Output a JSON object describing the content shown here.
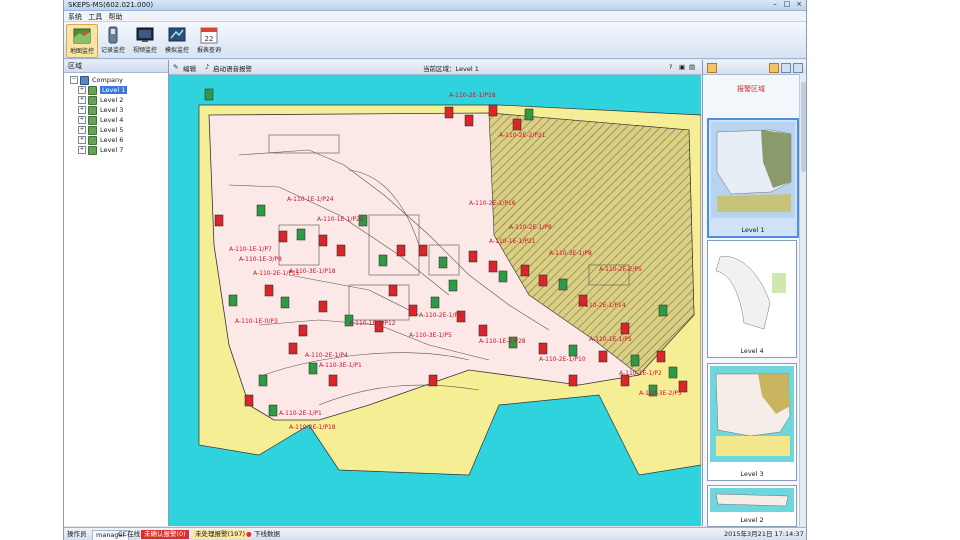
{
  "window": {
    "title": "SKEPS-MS(602.021.000)",
    "minimize": "–",
    "maximize": "□",
    "close": "×"
  },
  "menu": [
    {
      "label": "系统"
    },
    {
      "label": "工具"
    },
    {
      "label": "帮助"
    }
  ],
  "toolbar": [
    {
      "label": "地图监控",
      "icon": "map-icon",
      "active": true
    },
    {
      "label": "记录监控",
      "icon": "record-icon"
    },
    {
      "label": "视频监控",
      "icon": "video-icon"
    },
    {
      "label": "模拟监控",
      "icon": "simulate-icon"
    },
    {
      "label": "报表查询",
      "icon": "calendar-icon",
      "day": "22"
    }
  ],
  "left_panel": {
    "title": "区域",
    "root": "Company",
    "levels": [
      "Level 1",
      "Level 2",
      "Level 3",
      "Level 4",
      "Level 5",
      "Level 6",
      "Level 7"
    ],
    "selected": "Level 1"
  },
  "center_header": {
    "edit_label": "编辑",
    "alarm_label": "启动语音报警",
    "area_label": "当前区域：Level 1"
  },
  "map": {
    "sea_color": "#2fd3dd",
    "land_color": "#fce9e7",
    "beach_color": "#f6ee95",
    "hatch_color": "#c9b560",
    "labels": [
      "A-110-2E-1/P18",
      "A-110-1E-1/P24",
      "A-110-1E-1/P22",
      "A-110-1E-1/P7",
      "A-110-1E-3/P8",
      "A-110-1E-0/P3",
      "A-110-2E-2/P21",
      "A-110-2E-1/P16",
      "A-110-2E-1/P8",
      "A-110-3E-1/P8",
      "A-110-2E-2/P5",
      "A-110-2E-1/P15",
      "A-110-3E-1/P18",
      "A-110-2E-1/P3",
      "A-110-1E-2/P28",
      "A-110-2E-1/P14",
      "A-110-1E-1/P5",
      "A-110-2E-1/P4",
      "A-110-3E-1/P1",
      "A-110-2E-1/P10",
      "A-110-1E-1/P2",
      "A-110-3E-2/P5",
      "A-110-2E-1/P1",
      "A-110-2E-1/P18",
      "A-110-3E-1/P5",
      "A-110-1E-1/P21",
      "A-110-1E-1/P12"
    ]
  },
  "right_panel": {
    "title": "报警区域",
    "thumbs": [
      {
        "caption": "Level 1",
        "selected": true
      },
      {
        "caption": "Level 4"
      },
      {
        "caption": "Level 3"
      },
      {
        "caption": "Level 2"
      }
    ]
  },
  "status": {
    "operator_label": "操作员",
    "operator": "manager",
    "online": "CC在线",
    "alarm_unack": "未确认报警(0)",
    "alarm_unhandled": "未处理报警(197)",
    "offline": "下线数据",
    "datetime": "2015年3月21日  17:14:37"
  }
}
